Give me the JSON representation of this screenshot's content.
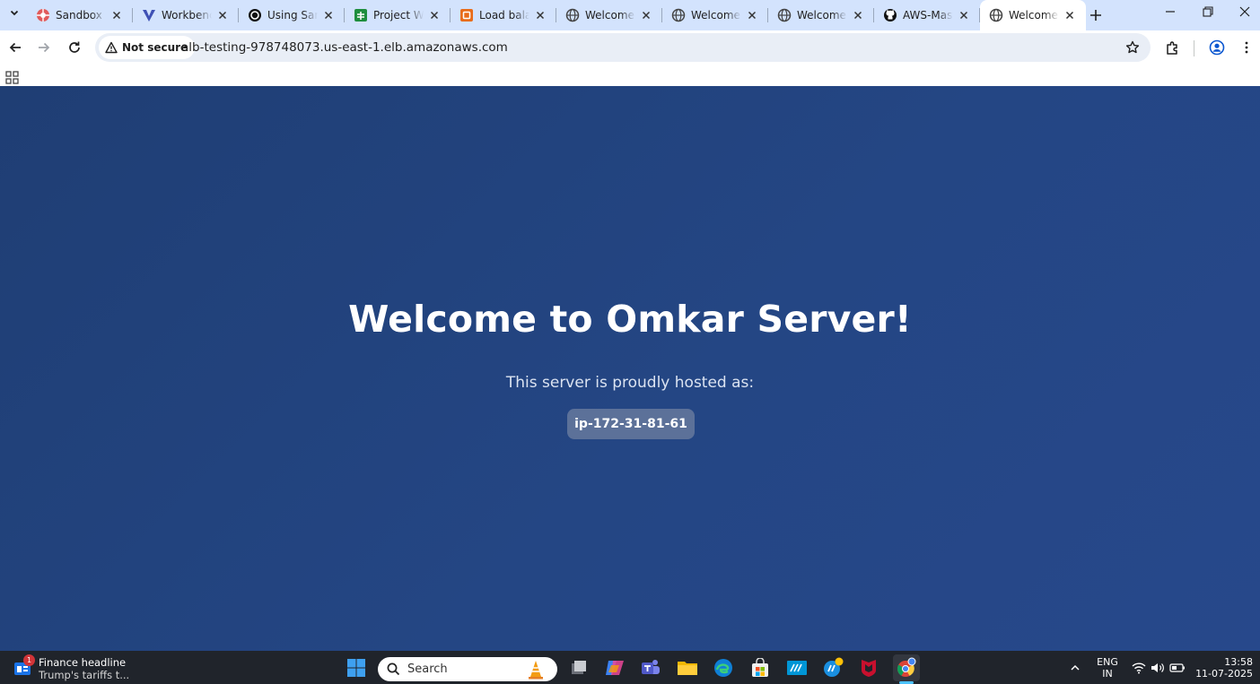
{
  "browser": {
    "tabs": [
      {
        "title": "Sandbox Environment",
        "icon": "sandbox-icon",
        "active": false
      },
      {
        "title": "Workbench",
        "icon": "vite-icon",
        "active": false
      },
      {
        "title": "Using Sample",
        "icon": "openai-icon",
        "active": false
      },
      {
        "title": "Project Week",
        "icon": "sheets-icon",
        "active": false
      },
      {
        "title": "Load balancers",
        "icon": "aws-icon",
        "active": false
      },
      {
        "title": "Welcome to",
        "icon": "globe-icon",
        "active": false
      },
      {
        "title": "Welcome to",
        "icon": "globe-icon",
        "active": false
      },
      {
        "title": "Welcome to",
        "icon": "globe-icon",
        "active": false
      },
      {
        "title": "AWS-Master",
        "icon": "github-icon",
        "active": false
      },
      {
        "title": "Welcome to",
        "icon": "globe-icon",
        "active": true
      }
    ],
    "address": {
      "security_label": "Not secure",
      "url": "alb-testing-978748073.us-east-1.elb.amazonaws.com"
    }
  },
  "page": {
    "heading": "Welcome to Omkar Server!",
    "subtitle": "This server is proudly hosted as:",
    "hostname": "ip-172-31-81-61"
  },
  "taskbar": {
    "news": {
      "badge": "1",
      "headline": "Finance headline",
      "text": "Trump's tariffs t..."
    },
    "search_placeholder": "Search",
    "language": {
      "line1": "ENG",
      "line2": "IN"
    },
    "clock": {
      "time": "13:58",
      "date": "11-07-2025"
    }
  }
}
